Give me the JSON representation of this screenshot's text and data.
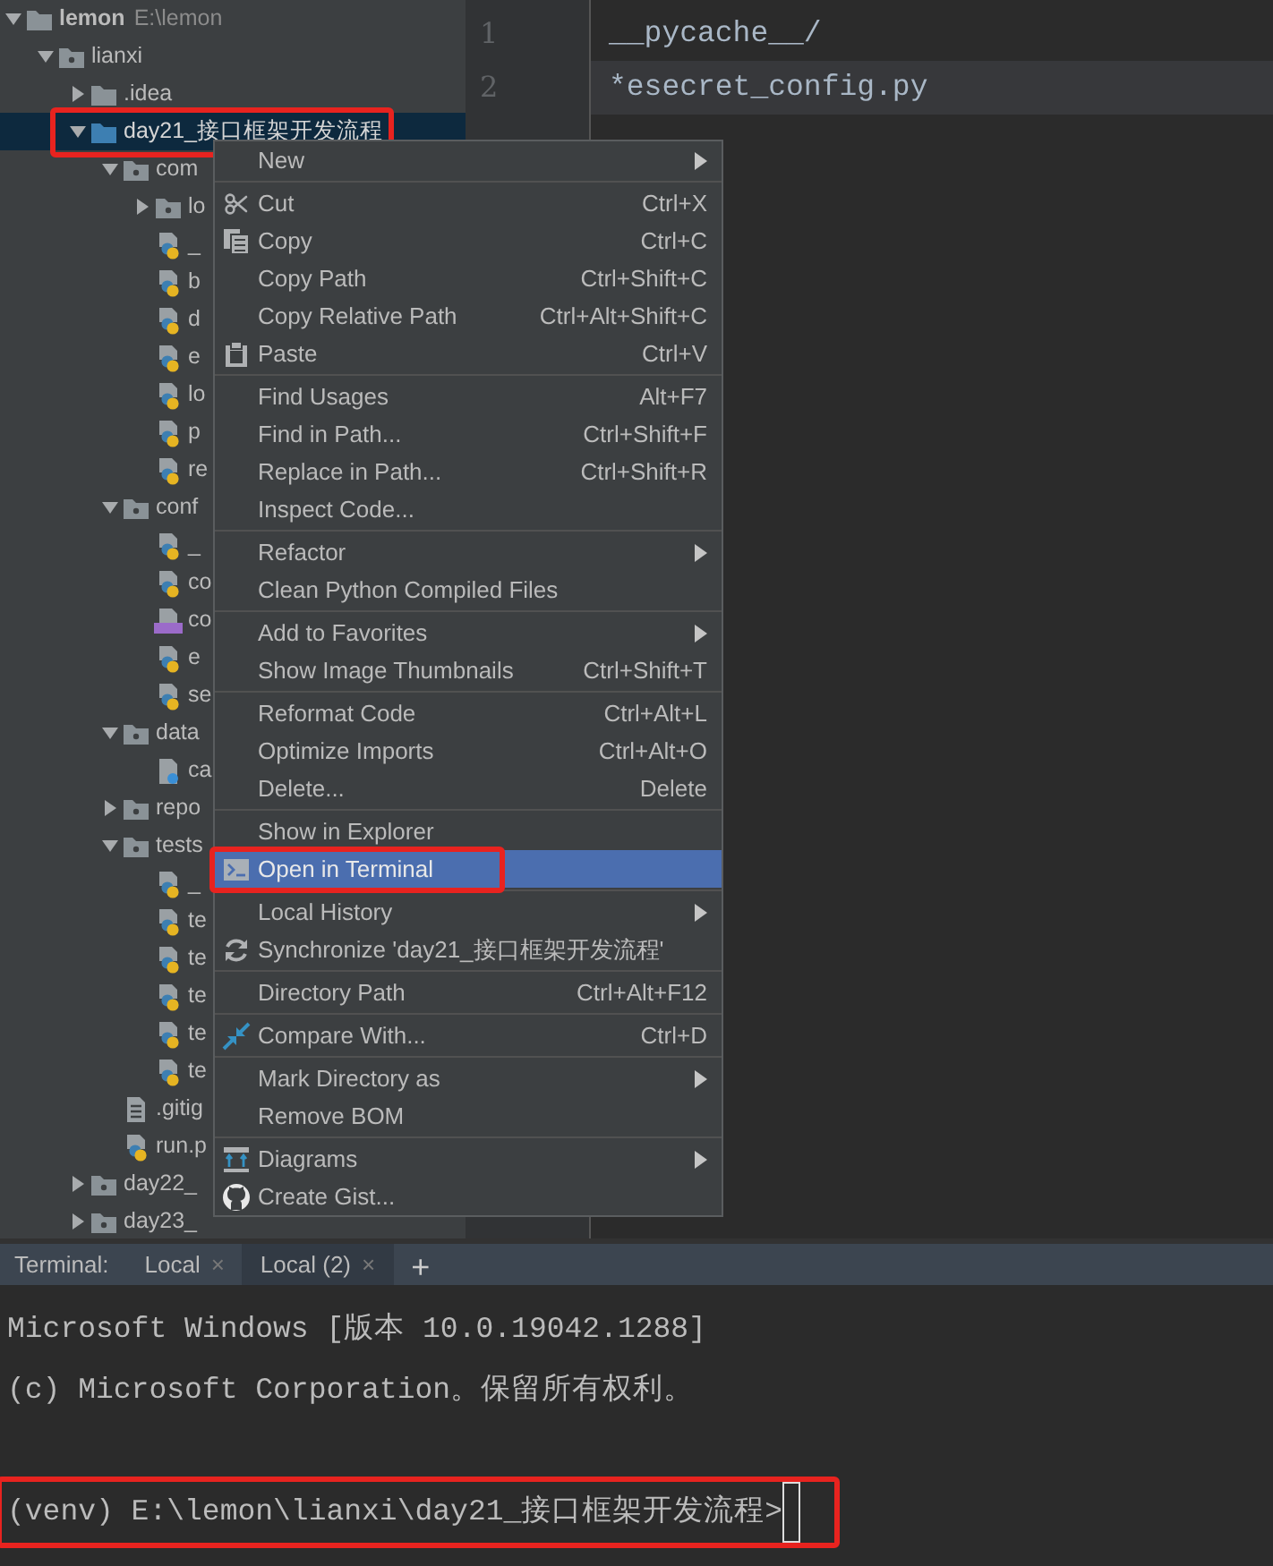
{
  "project_tree": [
    {
      "label": "lemon",
      "path": "E:\\lemon",
      "kind": "folder",
      "expanded": true,
      "selected": false,
      "highlighted": false,
      "children": [
        {
          "label": "lianxi",
          "kind": "package",
          "expanded": true,
          "selected": false,
          "highlighted": false,
          "children": [
            {
              "label": ".idea",
              "kind": "folder",
              "expanded": false,
              "selected": false,
              "highlighted": false
            },
            {
              "label": "day21_接口框架开发流程",
              "kind": "source",
              "expanded": true,
              "selected": true,
              "highlighted": true,
              "children": [
                {
                  "label": "com",
                  "kind": "package",
                  "expanded": true,
                  "selected": false,
                  "highlighted": false,
                  "children": [
                    {
                      "label": "lo",
                      "kind": "package",
                      "expanded": false,
                      "selected": false,
                      "highlighted": false
                    },
                    {
                      "label": "_",
                      "kind": "python",
                      "selected": false,
                      "highlighted": false
                    },
                    {
                      "label": "b",
                      "kind": "python",
                      "selected": false,
                      "highlighted": false
                    },
                    {
                      "label": "d",
                      "kind": "python",
                      "selected": false,
                      "highlighted": false
                    },
                    {
                      "label": "e",
                      "kind": "python",
                      "selected": false,
                      "highlighted": false
                    },
                    {
                      "label": "lo",
                      "kind": "python",
                      "selected": false,
                      "highlighted": false
                    },
                    {
                      "label": "p",
                      "kind": "python",
                      "selected": false,
                      "highlighted": false
                    },
                    {
                      "label": "re",
                      "kind": "python",
                      "selected": false,
                      "highlighted": false
                    }
                  ]
                },
                {
                  "label": "conf",
                  "kind": "package",
                  "expanded": true,
                  "selected": false,
                  "highlighted": false,
                  "children": [
                    {
                      "label": "_",
                      "kind": "python",
                      "selected": false,
                      "highlighted": false
                    },
                    {
                      "label": "co",
                      "kind": "python",
                      "selected": false,
                      "highlighted": false
                    },
                    {
                      "label": "co",
                      "kind": "yaml",
                      "selected": false,
                      "highlighted": false
                    },
                    {
                      "label": "e",
                      "kind": "python",
                      "selected": false,
                      "highlighted": false
                    },
                    {
                      "label": "se",
                      "kind": "python",
                      "selected": false,
                      "highlighted": false
                    }
                  ]
                },
                {
                  "label": "data",
                  "kind": "package",
                  "expanded": true,
                  "selected": false,
                  "highlighted": false,
                  "children": [
                    {
                      "label": "ca",
                      "kind": "unknown",
                      "selected": false,
                      "highlighted": false
                    }
                  ]
                },
                {
                  "label": "repo",
                  "kind": "package",
                  "expanded": false,
                  "selected": false,
                  "highlighted": false
                },
                {
                  "label": "tests",
                  "kind": "package",
                  "expanded": true,
                  "selected": false,
                  "highlighted": false,
                  "children": [
                    {
                      "label": "_",
                      "kind": "python",
                      "selected": false,
                      "highlighted": false
                    },
                    {
                      "label": "te",
                      "kind": "python",
                      "selected": false,
                      "highlighted": false
                    },
                    {
                      "label": "te",
                      "kind": "python",
                      "selected": false,
                      "highlighted": false
                    },
                    {
                      "label": "te",
                      "kind": "python",
                      "selected": false,
                      "highlighted": false
                    },
                    {
                      "label": "te",
                      "kind": "python",
                      "selected": false,
                      "highlighted": false
                    },
                    {
                      "label": "te",
                      "kind": "python",
                      "selected": false,
                      "highlighted": false
                    }
                  ]
                },
                {
                  "label": ".gitig",
                  "kind": "text",
                  "selected": false,
                  "highlighted": false
                },
                {
                  "label": "run.p",
                  "kind": "python",
                  "selected": false,
                  "highlighted": false
                }
              ]
            },
            {
              "label": "day22_",
              "kind": "package",
              "expanded": false,
              "selected": false,
              "highlighted": false
            },
            {
              "label": "day23_",
              "kind": "package",
              "expanded": false,
              "selected": false,
              "highlighted": false
            }
          ]
        }
      ]
    }
  ],
  "editor": {
    "lines": [
      {
        "number": "1",
        "text": "__pycache__/",
        "current": false
      },
      {
        "number": "2",
        "text": "*esecret_config.py",
        "current": true
      }
    ]
  },
  "context_menu": {
    "groups": [
      [
        {
          "label": "New",
          "kind": "plain",
          "submenu": true,
          "selected": false,
          "highlighted": false
        }
      ],
      [
        {
          "label": "Cut",
          "shortcut": "Ctrl+X",
          "kind": "cut",
          "submenu": false,
          "selected": false,
          "highlighted": false
        },
        {
          "label": "Copy",
          "shortcut": "Ctrl+C",
          "kind": "copy",
          "submenu": false,
          "selected": false,
          "highlighted": false
        },
        {
          "label": "Copy Path",
          "shortcut": "Ctrl+Shift+C",
          "kind": "plain",
          "submenu": false,
          "selected": false,
          "highlighted": false
        },
        {
          "label": "Copy Relative Path",
          "shortcut": "Ctrl+Alt+Shift+C",
          "kind": "plain",
          "submenu": false,
          "selected": false,
          "highlighted": false
        },
        {
          "label": "Paste",
          "shortcut": "Ctrl+V",
          "kind": "paste",
          "submenu": false,
          "selected": false,
          "highlighted": false
        }
      ],
      [
        {
          "label": "Find Usages",
          "shortcut": "Alt+F7",
          "kind": "plain",
          "submenu": false,
          "selected": false,
          "highlighted": false
        },
        {
          "label": "Find in Path...",
          "shortcut": "Ctrl+Shift+F",
          "kind": "plain",
          "submenu": false,
          "selected": false,
          "highlighted": false
        },
        {
          "label": "Replace in Path...",
          "shortcut": "Ctrl+Shift+R",
          "kind": "plain",
          "submenu": false,
          "selected": false,
          "highlighted": false
        },
        {
          "label": "Inspect Code...",
          "kind": "plain",
          "submenu": false,
          "selected": false,
          "highlighted": false
        }
      ],
      [
        {
          "label": "Refactor",
          "kind": "plain",
          "submenu": true,
          "selected": false,
          "highlighted": false
        },
        {
          "label": "Clean Python Compiled Files",
          "kind": "plain",
          "submenu": false,
          "selected": false,
          "highlighted": false
        }
      ],
      [
        {
          "label": "Add to Favorites",
          "kind": "plain",
          "submenu": true,
          "selected": false,
          "highlighted": false
        },
        {
          "label": "Show Image Thumbnails",
          "shortcut": "Ctrl+Shift+T",
          "kind": "plain",
          "submenu": false,
          "selected": false,
          "highlighted": false
        }
      ],
      [
        {
          "label": "Reformat Code",
          "shortcut": "Ctrl+Alt+L",
          "kind": "plain",
          "submenu": false,
          "selected": false,
          "highlighted": false
        },
        {
          "label": "Optimize Imports",
          "shortcut": "Ctrl+Alt+O",
          "kind": "plain",
          "submenu": false,
          "selected": false,
          "highlighted": false
        },
        {
          "label": "Delete...",
          "shortcut": "Delete",
          "kind": "plain",
          "submenu": false,
          "selected": false,
          "highlighted": false
        }
      ],
      [
        {
          "label": "Show in Explorer",
          "kind": "plain",
          "submenu": false,
          "selected": false,
          "highlighted": false
        },
        {
          "label": "Open in Terminal",
          "kind": "terminal",
          "submenu": false,
          "selected": true,
          "highlighted": true
        }
      ],
      [
        {
          "label": "Local History",
          "kind": "plain",
          "submenu": true,
          "selected": false,
          "highlighted": false
        },
        {
          "label": "Synchronize 'day21_接口框架开发流程'",
          "kind": "sync",
          "submenu": false,
          "selected": false,
          "highlighted": false
        }
      ],
      [
        {
          "label": "Directory Path",
          "shortcut": "Ctrl+Alt+F12",
          "kind": "plain",
          "submenu": false,
          "selected": false,
          "highlighted": false
        }
      ],
      [
        {
          "label": "Compare With...",
          "shortcut": "Ctrl+D",
          "kind": "compare",
          "submenu": false,
          "selected": false,
          "highlighted": false
        }
      ],
      [
        {
          "label": "Mark Directory as",
          "kind": "plain",
          "submenu": true,
          "selected": false,
          "highlighted": false
        },
        {
          "label": "Remove BOM",
          "kind": "plain",
          "submenu": false,
          "selected": false,
          "highlighted": false
        }
      ],
      [
        {
          "label": "Diagrams",
          "kind": "diagram",
          "submenu": true,
          "selected": false,
          "highlighted": false
        },
        {
          "label": "Create Gist...",
          "kind": "gist",
          "submenu": false,
          "selected": false,
          "highlighted": false
        }
      ]
    ]
  },
  "terminal": {
    "title": "Terminal:",
    "add_button": "+",
    "tabs": [
      {
        "label": "Local",
        "close": "×",
        "selected": false
      },
      {
        "label": "Local (2)",
        "close": "×",
        "selected": true
      }
    ],
    "lines": [
      {
        "kind": "output",
        "text": "Microsoft Windows [版本 10.0.19042.1288]",
        "highlighted": false,
        "cursor": false
      },
      {
        "kind": "output",
        "text": "(c) Microsoft Corporation。保留所有权利。",
        "highlighted": false,
        "cursor": false
      },
      {
        "kind": "prompt",
        "text": "(venv) E:\\lemon\\lianxi\\day21_接口框架开发流程>",
        "highlighted": true,
        "cursor": true
      }
    ]
  }
}
